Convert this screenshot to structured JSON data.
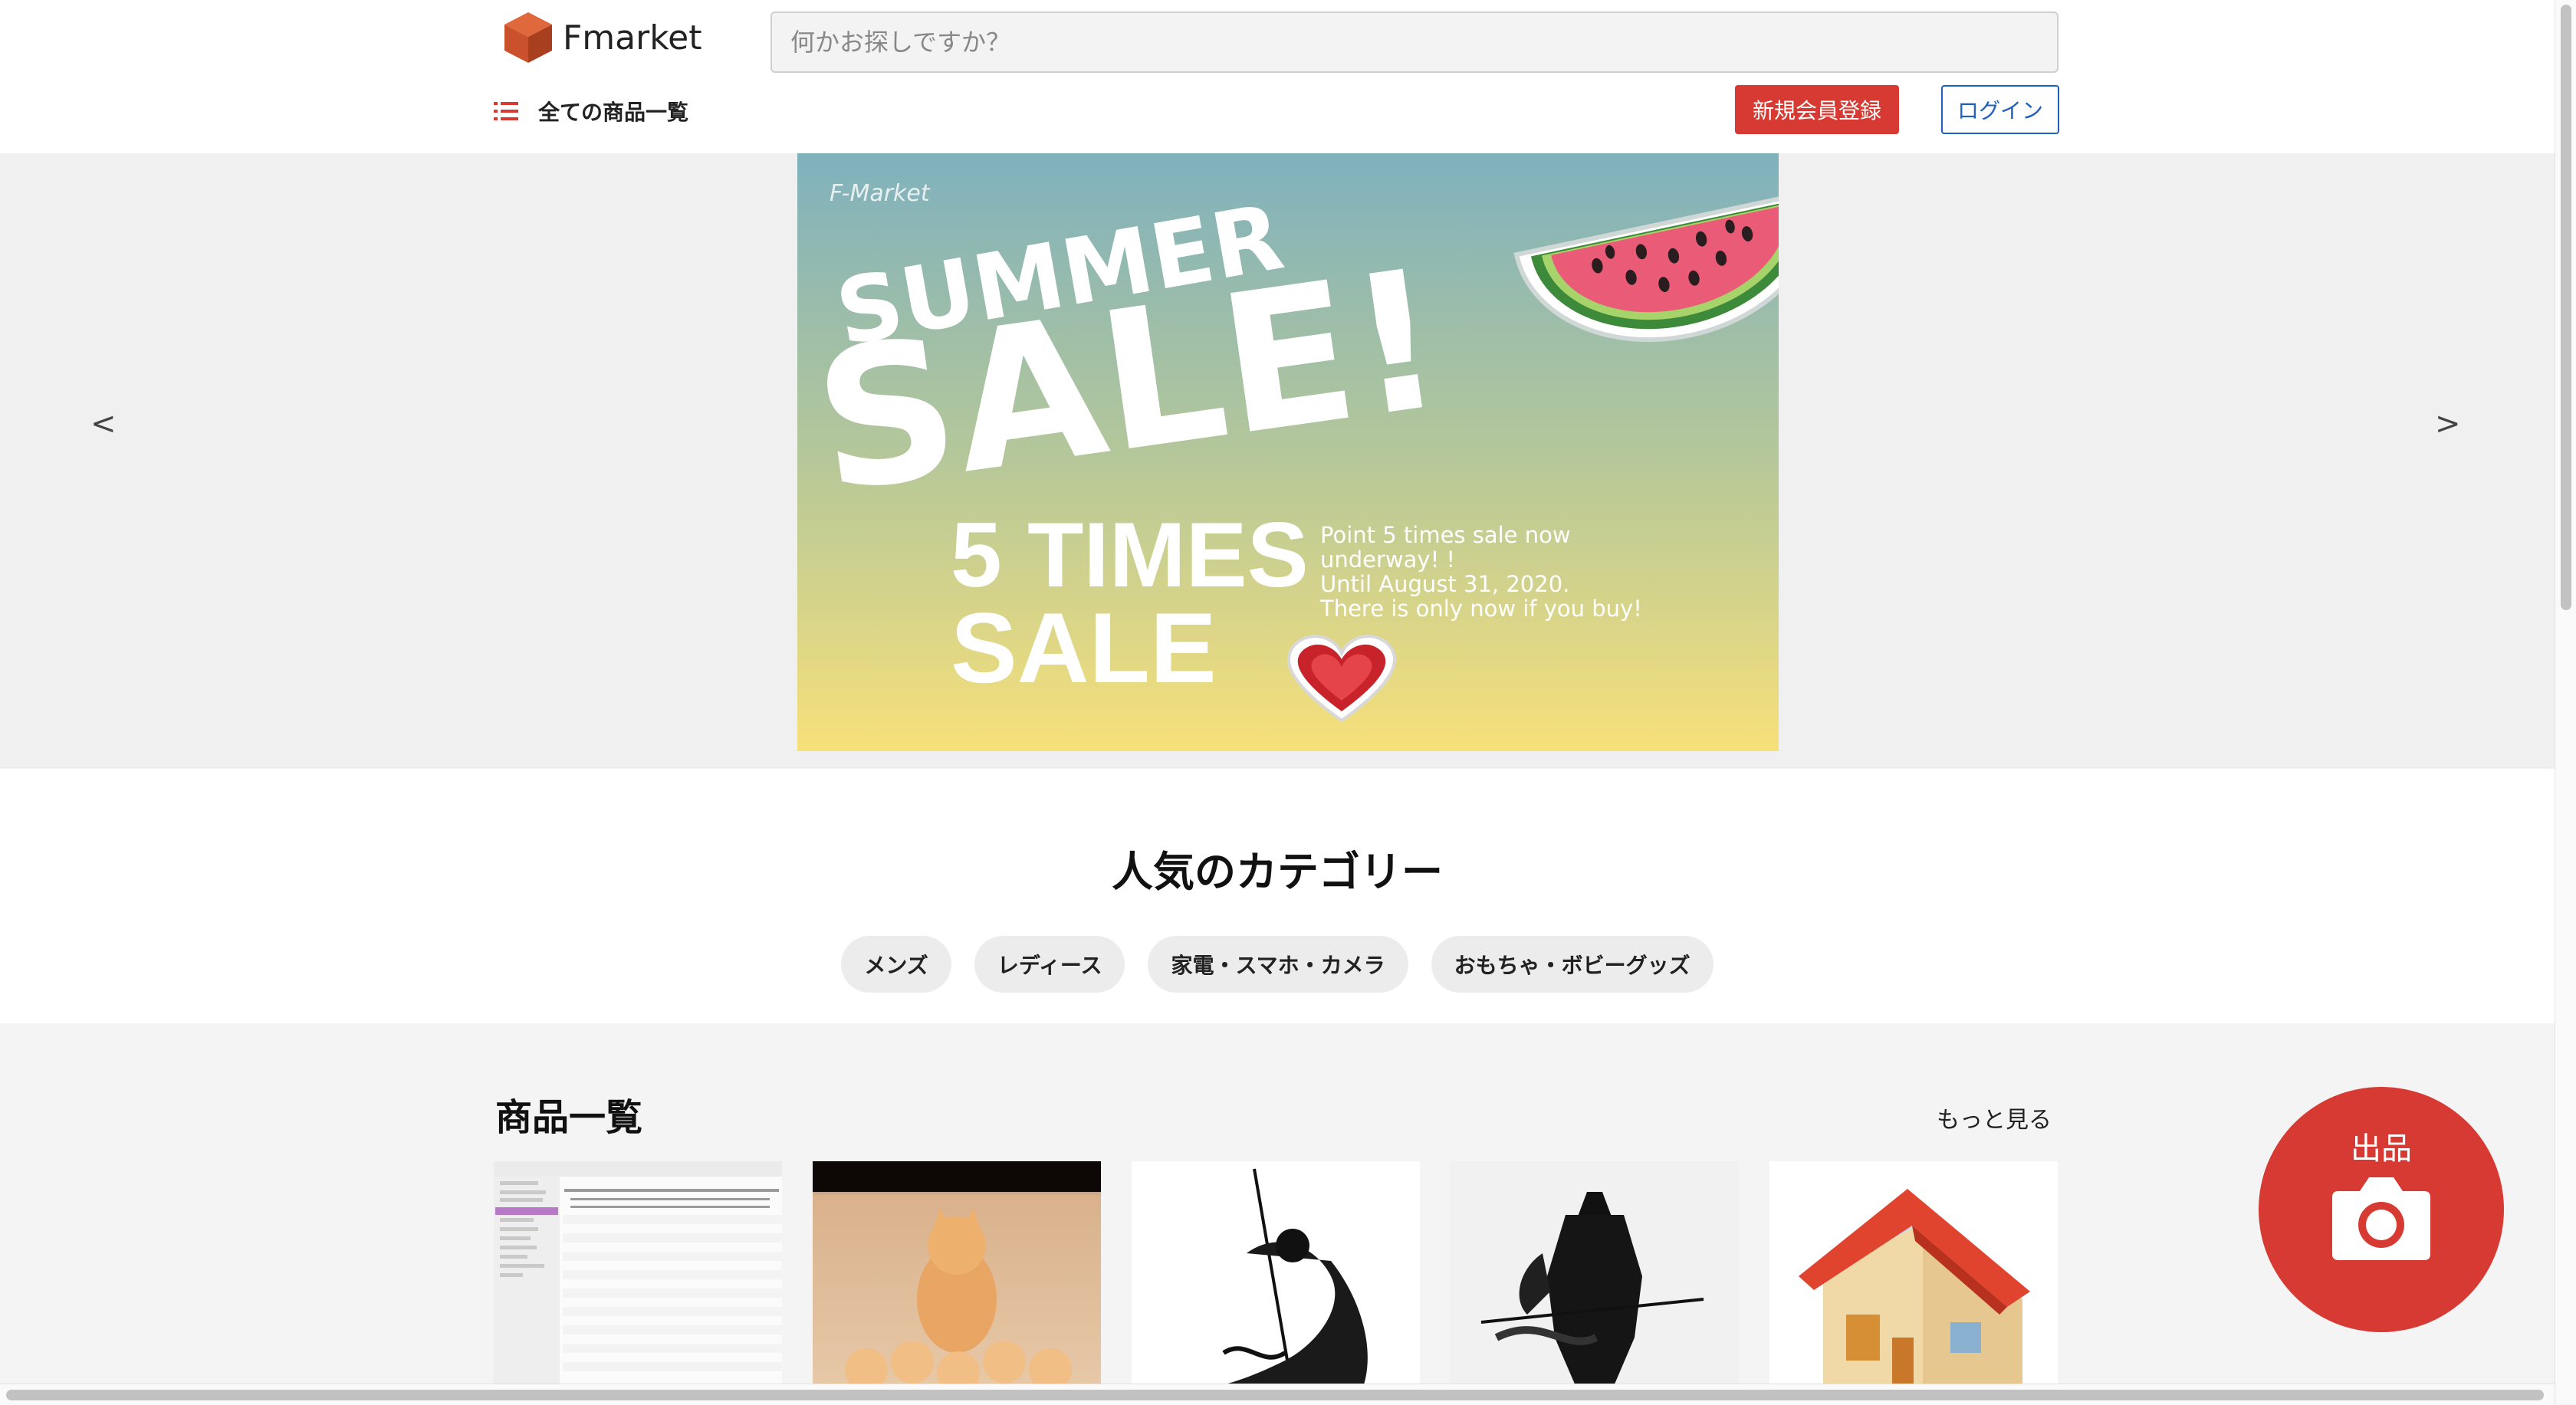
{
  "header": {
    "logo_text": "Fmarket",
    "search_placeholder": "何かお探しですか？",
    "all_products_label": "全ての商品一覧",
    "register_label": "新規会員登録",
    "login_label": "ログイン"
  },
  "carousel": {
    "prev_label": "<",
    "next_label": ">",
    "banner": {
      "brand": "F-Market",
      "headline_top": "SUMMER",
      "headline_main": "SALE!",
      "promo_line1": "5 TIMES",
      "promo_line2": "SALE",
      "note_lines": [
        "Point 5 times sale now",
        "underway! !",
        "Until August 31, 2020.",
        "There is only now if you buy!"
      ]
    }
  },
  "categories": {
    "title": "人気のカテゴリー",
    "items": [
      "メンズ",
      "レディース",
      "家電・スマホ・カメラ",
      "おもちゃ・ボビーグッズ"
    ]
  },
  "products": {
    "title": "商品一覧",
    "more_label": "もっと見る",
    "items": [
      {
        "image": "database-screenshot"
      },
      {
        "image": "cat-and-kittens"
      },
      {
        "image": "samurai-sword-ink"
      },
      {
        "image": "samurai-armor-ink"
      },
      {
        "image": "house-illustration"
      }
    ]
  },
  "sell_button": {
    "label": "出品",
    "icon": "camera-icon"
  },
  "colors": {
    "accent": "#d63a32",
    "login_border": "#1f5fbf"
  }
}
